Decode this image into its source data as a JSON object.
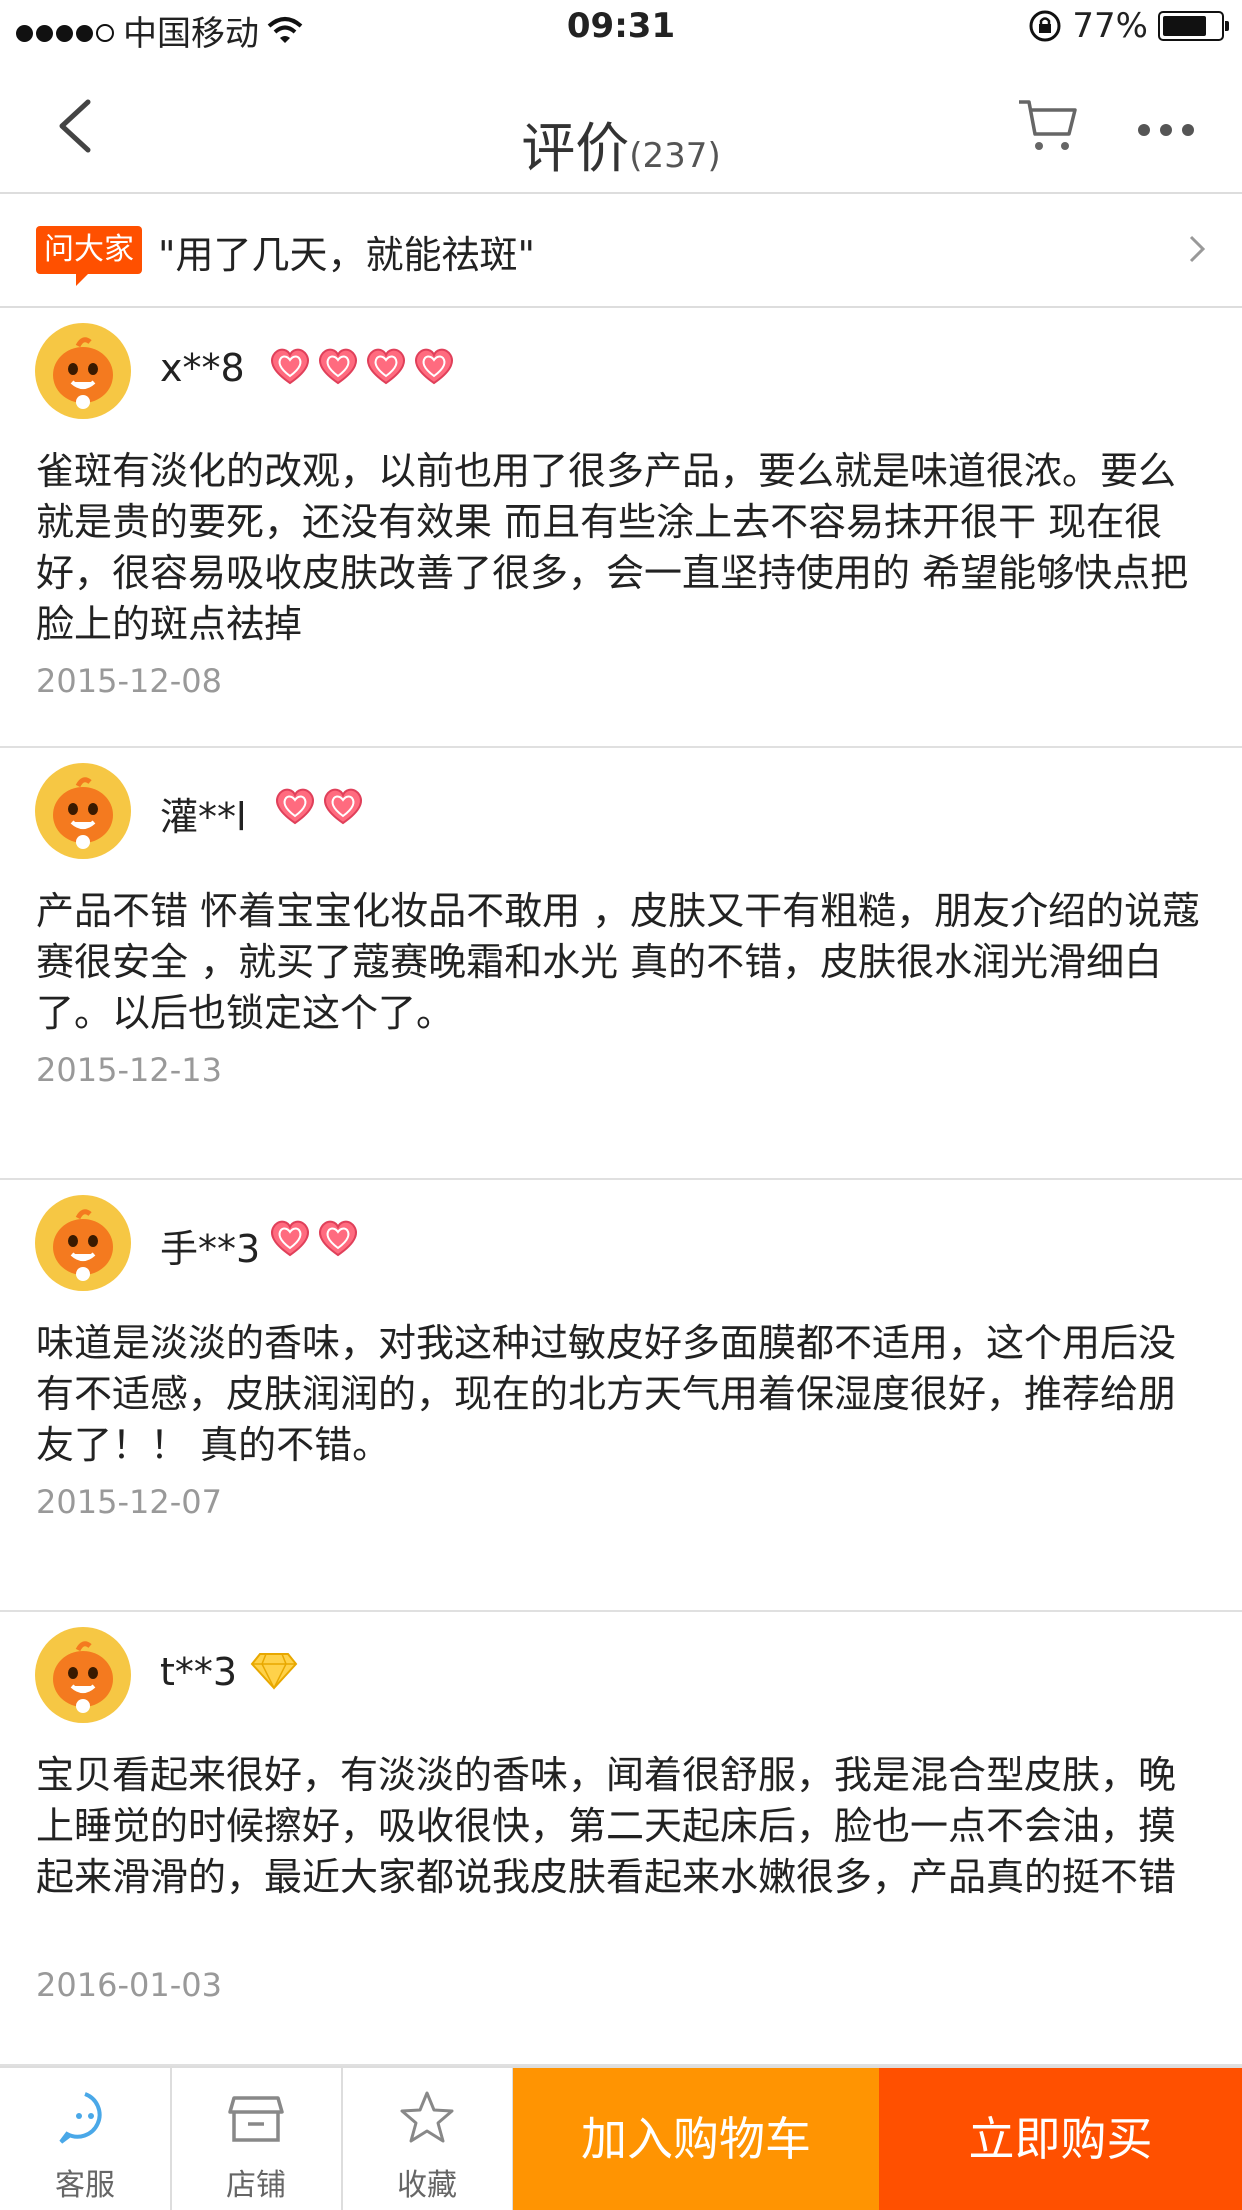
{
  "status_bar": {
    "carrier": "中国移动",
    "time": "09:31",
    "battery": "77%",
    "battery_level": 0.77,
    "icons": [
      "signal-dots",
      "wifi-icon",
      "rotation-lock-icon",
      "battery-icon"
    ]
  },
  "nav": {
    "title": "评价",
    "count": "(237)",
    "icons": [
      "back-icon",
      "cart-icon",
      "more-icon"
    ]
  },
  "ask": {
    "tag": "问大家",
    "question": "\"用了几天，就能祛斑\""
  },
  "reviews": [
    {
      "user": "x**8",
      "badge": "hearts",
      "badge_count": 4,
      "text": "雀斑有淡化的改观，以前也用了很多产品，要么就是味道很浓。要么就是贵的要死，还没有效果 而且有些涂上去不容易抹开很干 现在很好，很容易吸收皮肤改善了很多，会一直坚持使用的 希望能够快点把脸上的斑点祛掉",
      "date": "2015-12-08"
    },
    {
      "user": "灌**l",
      "badge": "hearts",
      "badge_count": 2,
      "text": "产品不错 怀着宝宝化妆品不敢用 ，皮肤又干有粗糙，朋友介绍的说蔻赛很安全 ，就买了蔻赛晚霜和水光 真的不错，皮肤很水润光滑细白了。以后也锁定这个了。",
      "date": "2015-12-13"
    },
    {
      "user": "手**3",
      "badge": "hearts",
      "badge_count": 2,
      "text": "味道是淡淡的香味，对我这种过敏皮好多面膜都不适用，这个用后没有不适感，皮肤润润的，现在的北方天气用着保湿度很好，推荐给朋友了！！ 真的不错。",
      "date": "2015-12-07"
    },
    {
      "user": "t**3",
      "badge": "diamond",
      "badge_count": 1,
      "text": "宝贝看起来很好，有淡淡的香味，闻着很舒服，我是混合型皮肤，晚上睡觉的时候擦好，吸收很快，第二天起床后，脸也一点不会油，摸起来滑滑的，最近大家都说我皮肤看起来水嫩很多，产品真的挺不错",
      "date": "2016-01-03"
    }
  ],
  "bottom_bar": {
    "service": "客服",
    "shop": "店铺",
    "favorite": "收藏",
    "add_to_cart": "加入购物车",
    "buy_now": "立即购买"
  },
  "colors": {
    "accent": "#ff5000",
    "cart_button": "#ff9402",
    "service_icon": "#4aa8e8"
  }
}
